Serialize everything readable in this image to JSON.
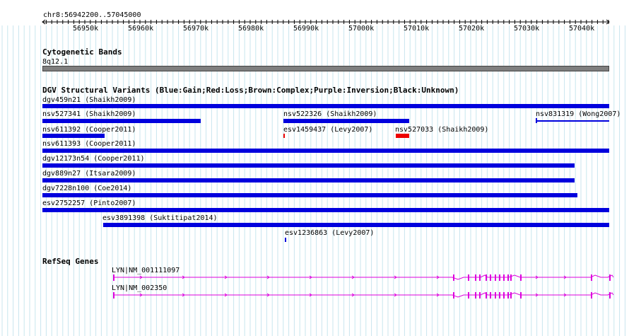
{
  "ruler": {
    "coord_label": "chr8:56942200..57045000",
    "ticks": [
      "56950k",
      "56960k",
      "56970k",
      "56980k",
      "56990k",
      "57000k",
      "57010k",
      "57020k",
      "57030k",
      "57040k"
    ]
  },
  "cytoband": {
    "title": "Cytogenetic Bands",
    "band_label": "8q12.1",
    "color": "#7f7f7f"
  },
  "dgv": {
    "title": "DGV Structural Variants (Blue:Gain;Red:Loss;Brown:Complex;Purple:Inversion;Black:Unknown)",
    "colors": {
      "gain": "#0000dd",
      "loss": "#ee0000"
    },
    "features": [
      {
        "name": "dgv459n21 (Shaikh2009)",
        "type": "gain"
      },
      {
        "name": "nsv527341 (Shaikh2009)",
        "type": "gain"
      },
      {
        "name": "nsv522326 (Shaikh2009)",
        "type": "gain"
      },
      {
        "name": "nsv831319 (Wong2007)",
        "type": "gain"
      },
      {
        "name": "nsv611392 (Cooper2011)",
        "type": "gain"
      },
      {
        "name": "esv1459437 (Levy2007)",
        "type": "loss"
      },
      {
        "name": "nsv527033 (Shaikh2009)",
        "type": "loss"
      },
      {
        "name": "nsv611393 (Cooper2011)",
        "type": "gain"
      },
      {
        "name": "dgv12173n54 (Cooper2011)",
        "type": "gain"
      },
      {
        "name": "dgv889n27 (Itsara2009)",
        "type": "gain"
      },
      {
        "name": "dgv7228n100 (Coe2014)",
        "type": "gain"
      },
      {
        "name": "esv2752257 (Pinto2007)",
        "type": "gain"
      },
      {
        "name": "esv3891398 (Suktitipat2014)",
        "type": "gain"
      },
      {
        "name": "esv1236863 (Levy2007)",
        "type": "gain"
      }
    ]
  },
  "refseq": {
    "title": "RefSeq Genes",
    "color": "#dd00dd",
    "genes": [
      {
        "label": "LYN|NM_001111097"
      },
      {
        "label": "LYN|NM_002350"
      }
    ]
  }
}
